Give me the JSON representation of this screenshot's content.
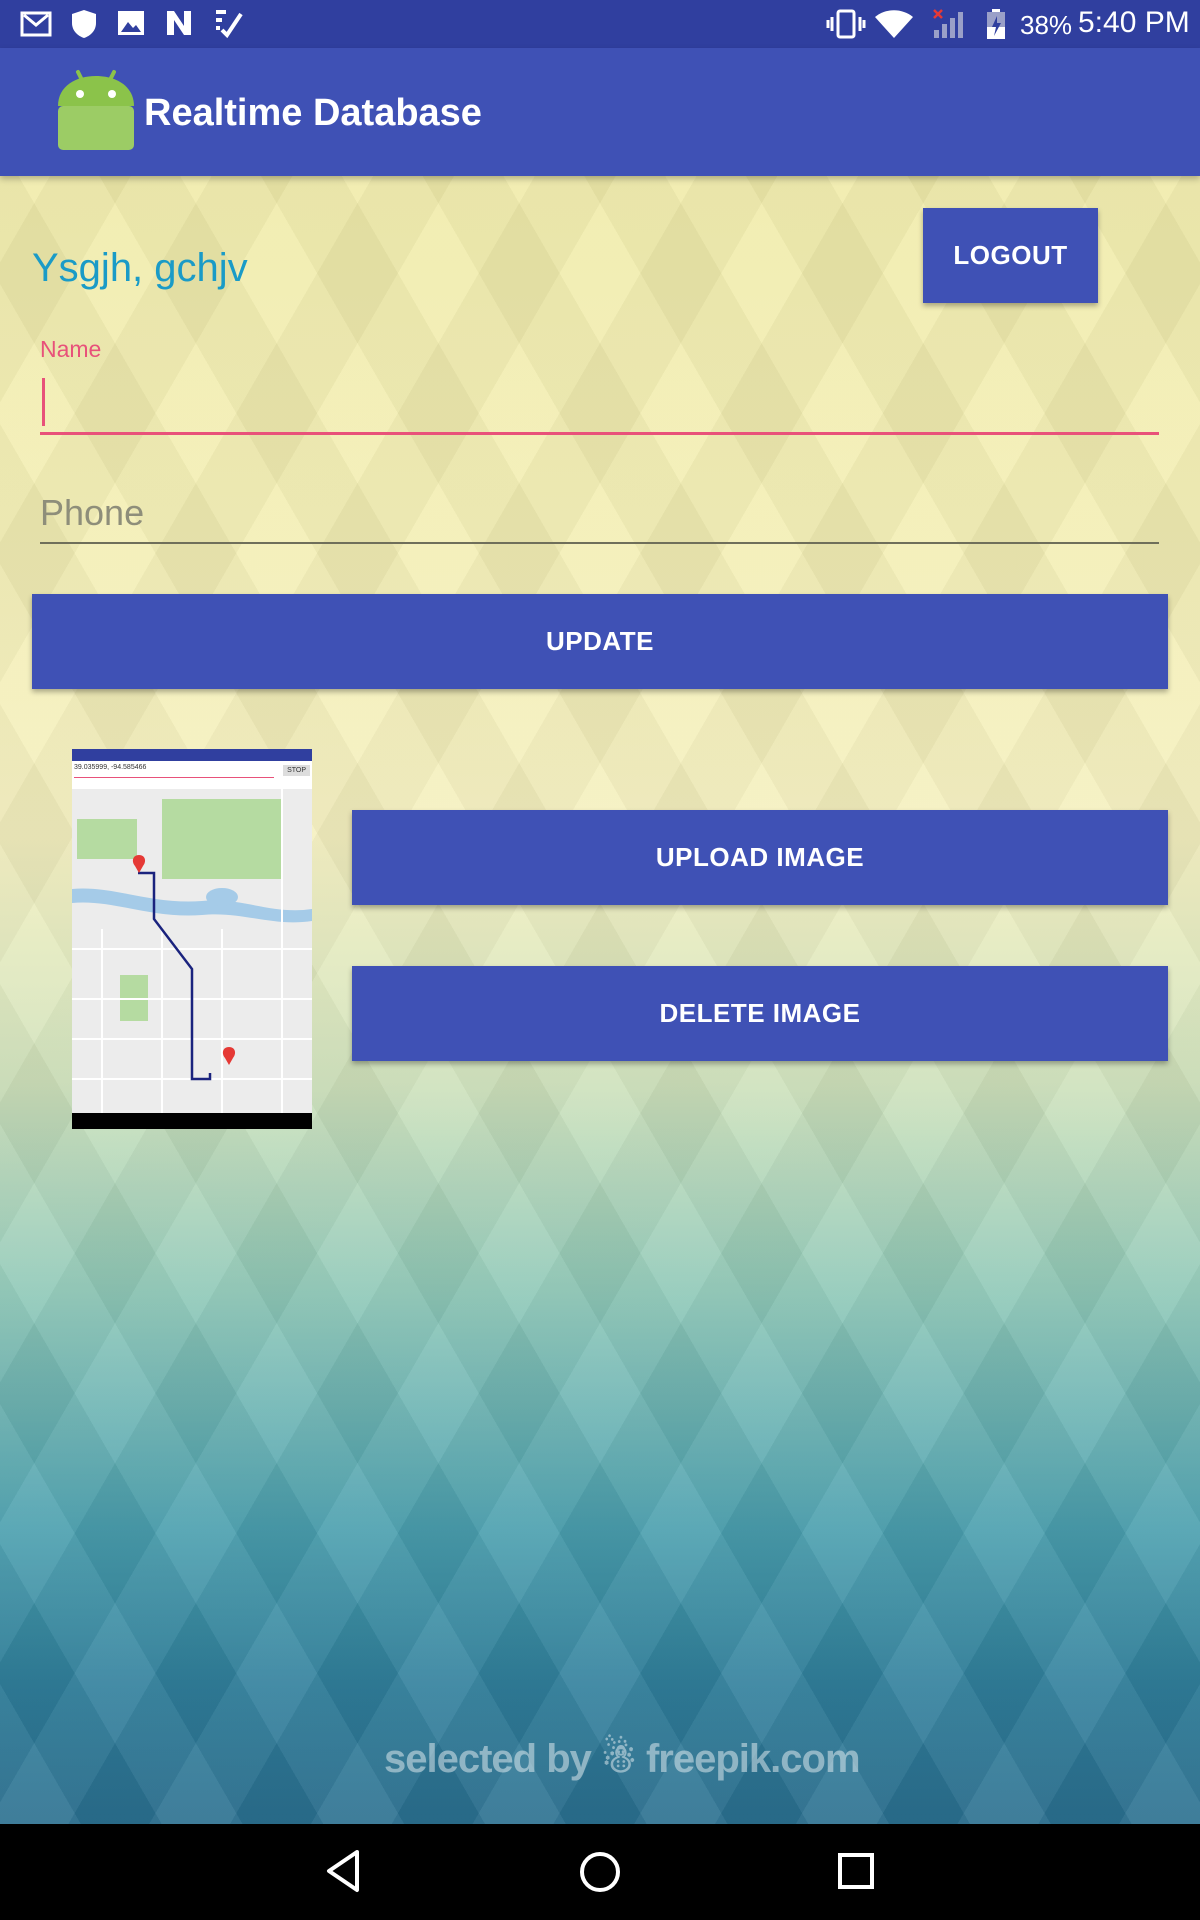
{
  "status_bar": {
    "battery": "38%",
    "time": "5:40 PM",
    "left_icons": [
      "gmail-icon",
      "shield-icon",
      "image-icon",
      "n-icon",
      "task-icon"
    ],
    "right_icons": [
      "vibrate-icon",
      "wifi-icon",
      "signal-icon",
      "battery-icon"
    ]
  },
  "app_bar": {
    "title": "Realtime Database",
    "logo": "android-icon"
  },
  "main": {
    "user_label": "Ysgjh, gchjv",
    "logout_label": "LOGOUT",
    "name_field": {
      "label": "Name",
      "value": ""
    },
    "phone_field": {
      "placeholder": "Phone",
      "value": ""
    },
    "update_label": "UPDATE",
    "upload_label": "UPLOAD IMAGE",
    "delete_label": "DELETE IMAGE",
    "thumbnail": {
      "coords": "39.035999, -94.585466",
      "stop_label": "STOP"
    }
  },
  "watermark": "selected by ☃ freepik.com",
  "nav_bar": {
    "icons": [
      "back-icon",
      "home-icon",
      "recents-icon"
    ]
  },
  "colors": {
    "primary": "#3f51b5",
    "primary_dark": "#303f9f",
    "accent": "#e8517a",
    "user_text": "#1a9bc7"
  }
}
